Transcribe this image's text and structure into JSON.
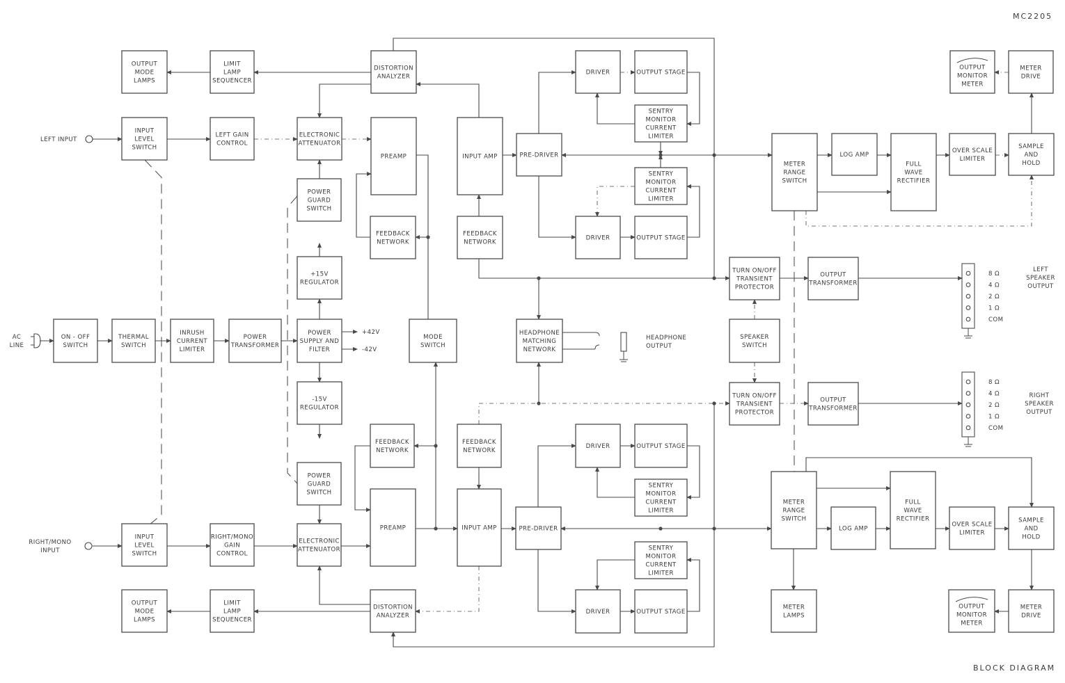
{
  "header": {
    "model": "MC2205"
  },
  "footer": {
    "caption": "BLOCK DIAGRAM"
  },
  "external_labels": {
    "left_input": "LEFT INPUT",
    "right_mono_input": [
      "RIGHT/MONO",
      "INPUT"
    ],
    "ac_line": [
      "AC",
      "LINE"
    ],
    "headphone_output": [
      "HEADPHONE",
      "OUTPUT"
    ],
    "left_speaker_output": [
      "LEFT",
      "SPEAKER",
      "OUTPUT"
    ],
    "right_speaker_output": [
      "RIGHT",
      "SPEAKER",
      "OUTPUT"
    ],
    "plus_42v": "+42V",
    "minus_42v": "-42V"
  },
  "speaker_taps": {
    "left": [
      "8 Ω",
      "4 Ω",
      "2 Ω",
      "1 Ω",
      "COM"
    ],
    "right": [
      "8 Ω",
      "4 Ω",
      "2 Ω",
      "1 Ω",
      "COM"
    ]
  },
  "blocks": [
    {
      "id": "l-output-mode-lamps",
      "lines": [
        "OUTPUT",
        "MODE",
        "LAMPS"
      ]
    },
    {
      "id": "l-limit-lamp-seq",
      "lines": [
        "LIMIT",
        "LAMP",
        "SEQUENCER"
      ]
    },
    {
      "id": "l-distortion",
      "lines": [
        "DISTORTION",
        "ANALYZER"
      ]
    },
    {
      "id": "l-input-level",
      "lines": [
        "INPUT",
        "LEVEL",
        "SWITCH"
      ]
    },
    {
      "id": "l-gain",
      "lines": [
        "LEFT GAIN",
        "CONTROL"
      ]
    },
    {
      "id": "l-attenuator",
      "lines": [
        "ELECTRONIC",
        "ATTENUATOR"
      ]
    },
    {
      "id": "l-preamp",
      "lines": [
        "PREAMP"
      ]
    },
    {
      "id": "l-input-amp",
      "lines": [
        "INPUT AMP"
      ]
    },
    {
      "id": "l-pre-driver",
      "lines": [
        "PRE-DRIVER"
      ]
    },
    {
      "id": "l-driver-a",
      "lines": [
        "DRIVER"
      ]
    },
    {
      "id": "l-output-a",
      "lines": [
        "OUTPUT STAGE"
      ]
    },
    {
      "id": "l-sentry-a",
      "lines": [
        "SENTRY",
        "MONITOR",
        "CURRENT",
        "LIMITER"
      ]
    },
    {
      "id": "l-sentry-b",
      "lines": [
        "SENTRY",
        "MONITOR",
        "CURRENT",
        "LIMITER"
      ]
    },
    {
      "id": "l-driver-b",
      "lines": [
        "DRIVER"
      ]
    },
    {
      "id": "l-output-b",
      "lines": [
        "OUTPUT STAGE"
      ]
    },
    {
      "id": "l-power-guard",
      "lines": [
        "POWER",
        "GUARD",
        "SWITCH"
      ]
    },
    {
      "id": "l-feedback-pre",
      "lines": [
        "FEEDBACK",
        "NETWORK"
      ]
    },
    {
      "id": "l-feedback-in",
      "lines": [
        "FEEDBACK",
        "NETWORK"
      ]
    },
    {
      "id": "l-meter-range",
      "lines": [
        "METER",
        "RANGE",
        "SWITCH"
      ]
    },
    {
      "id": "l-log-amp",
      "lines": [
        "LOG AMP"
      ]
    },
    {
      "id": "l-full-wave",
      "lines": [
        "FULL",
        "WAVE",
        "RECTIFIER"
      ]
    },
    {
      "id": "l-over-scale",
      "lines": [
        "OVER SCALE",
        "LIMITER"
      ]
    },
    {
      "id": "l-sample-hold",
      "lines": [
        "SAMPLE",
        "AND",
        "HOLD"
      ]
    },
    {
      "id": "l-meter-drive",
      "lines": [
        "METER",
        "DRIVE"
      ]
    },
    {
      "id": "l-monitor-meter",
      "lines": [
        "OUTPUT",
        "MONITOR",
        "METER"
      ]
    },
    {
      "id": "l-transient",
      "lines": [
        "TURN ON/OFF",
        "TRANSIENT",
        "PROTECTOR"
      ]
    },
    {
      "id": "l-out-xfmr",
      "lines": [
        "OUTPUT",
        "TRANSFORMER"
      ]
    },
    {
      "id": "reg-plus15",
      "lines": [
        "+15V",
        "REGULATOR"
      ]
    },
    {
      "id": "on-off",
      "lines": [
        "ON - OFF",
        "SWITCH"
      ]
    },
    {
      "id": "thermal",
      "lines": [
        "THERMAL",
        "SWITCH"
      ]
    },
    {
      "id": "inrush",
      "lines": [
        "INRUSH",
        "CURRENT",
        "LIMITER"
      ]
    },
    {
      "id": "power-xfmr",
      "lines": [
        "POWER",
        "TRANSFORMER"
      ]
    },
    {
      "id": "psu",
      "lines": [
        "POWER",
        "SUPPLY AND",
        "FILTER"
      ]
    },
    {
      "id": "mode-switch",
      "lines": [
        "MODE",
        "SWITCH"
      ]
    },
    {
      "id": "hp-network",
      "lines": [
        "HEADPHONE",
        "MATCHING",
        "NETWORK"
      ]
    },
    {
      "id": "speaker-switch",
      "lines": [
        "SPEAKER",
        "SWITCH"
      ]
    },
    {
      "id": "reg-minus15",
      "lines": [
        "-15V",
        "REGULATOR"
      ]
    },
    {
      "id": "r-transient",
      "lines": [
        "TURN ON/OFF",
        "TRANSIENT",
        "PROTECTOR"
      ]
    },
    {
      "id": "r-out-xfmr",
      "lines": [
        "OUTPUT",
        "TRANSFORMER"
      ]
    },
    {
      "id": "r-feedback-pre",
      "lines": [
        "FEEDBACK",
        "NETWORK"
      ]
    },
    {
      "id": "r-feedback-in",
      "lines": [
        "FEEDBACK",
        "NETWORK"
      ]
    },
    {
      "id": "r-driver-a",
      "lines": [
        "DRIVER"
      ]
    },
    {
      "id": "r-output-a",
      "lines": [
        "OUTPUT STAGE"
      ]
    },
    {
      "id": "r-sentry-a",
      "lines": [
        "SENTRY",
        "MONITOR",
        "CURRENT",
        "LIMITER"
      ]
    },
    {
      "id": "r-power-guard",
      "lines": [
        "POWER",
        "GUARD",
        "SWITCH"
      ]
    },
    {
      "id": "r-meter-range",
      "lines": [
        "METER",
        "RANGE",
        "SWITCH"
      ]
    },
    {
      "id": "r-full-wave",
      "lines": [
        "FULL",
        "WAVE",
        "RECTIFIER"
      ]
    },
    {
      "id": "r-input-level",
      "lines": [
        "INPUT",
        "LEVEL",
        "SWITCH"
      ]
    },
    {
      "id": "r-gain",
      "lines": [
        "RIGHT/MONO",
        "GAIN",
        "CONTROL"
      ]
    },
    {
      "id": "r-attenuator",
      "lines": [
        "ELECTRONIC",
        "ATTENUATOR"
      ]
    },
    {
      "id": "r-preamp",
      "lines": [
        "PREAMP"
      ]
    },
    {
      "id": "r-input-amp",
      "lines": [
        "INPUT AMP"
      ]
    },
    {
      "id": "r-pre-driver",
      "lines": [
        "PRE-DRIVER"
      ]
    },
    {
      "id": "r-log-amp",
      "lines": [
        "LOG AMP"
      ]
    },
    {
      "id": "r-over-scale",
      "lines": [
        "OVER SCALE",
        "LIMITER"
      ]
    },
    {
      "id": "r-sample-hold",
      "lines": [
        "SAMPLE",
        "AND",
        "HOLD"
      ]
    },
    {
      "id": "r-sentry-b",
      "lines": [
        "SENTRY",
        "MONITOR",
        "CURRENT",
        "LIMITER"
      ]
    },
    {
      "id": "r-output-mode-lamps",
      "lines": [
        "OUTPUT",
        "MODE",
        "LAMPS"
      ]
    },
    {
      "id": "r-limit-lamp-seq",
      "lines": [
        "LIMIT",
        "LAMP",
        "SEQUENCER"
      ]
    },
    {
      "id": "r-distortion",
      "lines": [
        "DISTORTION",
        "ANALYZER"
      ]
    },
    {
      "id": "r-driver-b",
      "lines": [
        "DRIVER"
      ]
    },
    {
      "id": "r-output-b",
      "lines": [
        "OUTPUT STAGE"
      ]
    },
    {
      "id": "r-meter-lamps",
      "lines": [
        "METER",
        "LAMPS"
      ]
    },
    {
      "id": "r-monitor-meter",
      "lines": [
        "OUTPUT",
        "MONITOR",
        "METER"
      ]
    },
    {
      "id": "r-meter-drive",
      "lines": [
        "METER",
        "DRIVE"
      ]
    }
  ]
}
